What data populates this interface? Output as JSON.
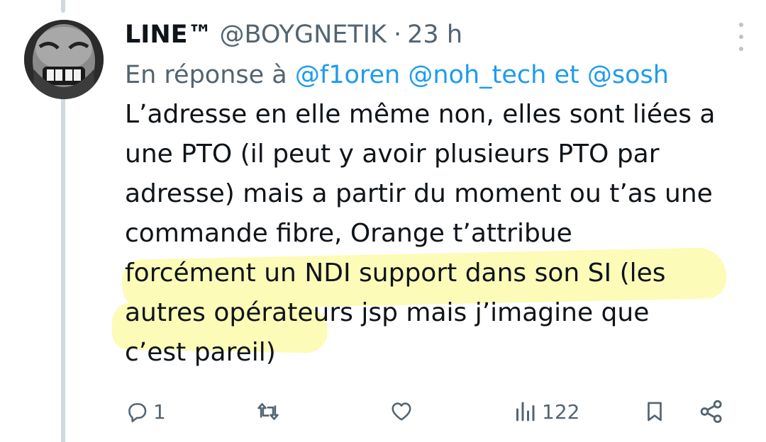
{
  "tweet": {
    "display_name": "LINE™",
    "handle": "@BOYGNETIK",
    "separator": "·",
    "time": "23 h",
    "reply_prefix": "En réponse à",
    "mentions": [
      "@f1oren",
      "@noh_tech"
    ],
    "reply_conjunction": "et",
    "last_mention": "@sosh",
    "text_lines": [
      "L’adresse en elle même non, elles sont liées a",
      "une PTO (il peut y avoir plusieurs PTO par",
      "adresse) mais a partir du moment ou t’as une",
      "commande fibre, Orange t’attribue",
      "forcément un NDI support dans son SI (les",
      "autres opérateurs jsp mais j’imagine que",
      "c’est pareil)"
    ],
    "highlight_color": "#fdfbb8"
  },
  "actions": {
    "reply_count": "1",
    "retweet_count": "",
    "like_count": "",
    "views_count": "122"
  },
  "icons": {
    "reply": "reply-icon",
    "retweet": "retweet-icon",
    "like": "heart-icon",
    "views": "views-icon",
    "bookmark": "bookmark-icon",
    "share": "share-icon",
    "more": "more-vertical-icon"
  },
  "colors": {
    "muted": "#536471",
    "link": "#1d9bf0",
    "text": "#0f1419"
  }
}
